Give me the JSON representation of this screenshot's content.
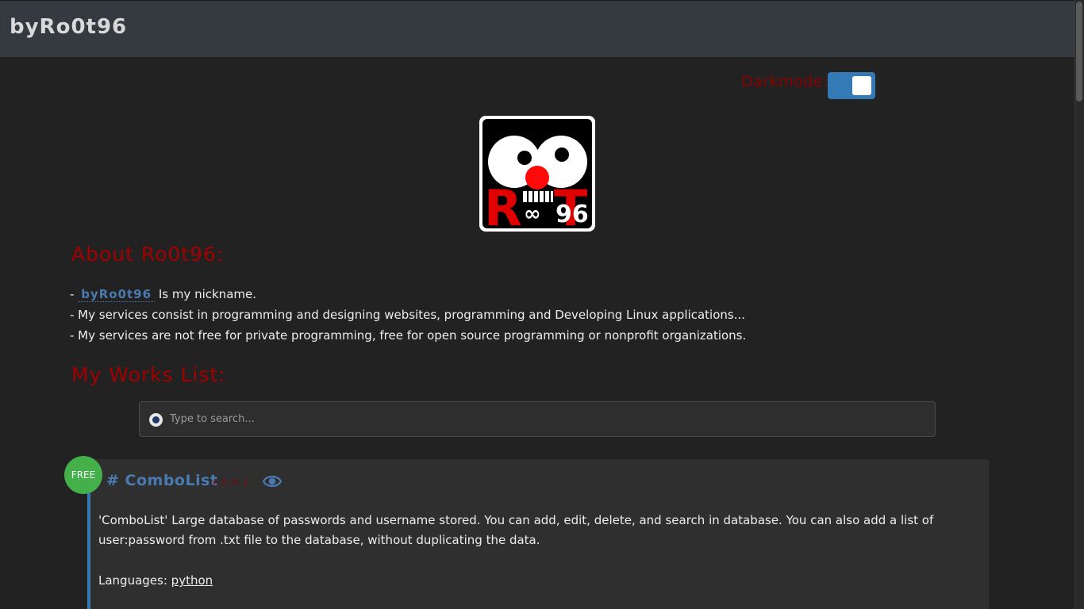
{
  "header": {
    "brand": "byRo0t96"
  },
  "darkmode": {
    "label": "Darkmode:",
    "enabled": true
  },
  "logo": {
    "alt": "Ro0t96 logo",
    "text_top": "OO",
    "text_mid": "R",
    "text_inf": "∞",
    "text_t": "T",
    "text_num": "96"
  },
  "about": {
    "heading": "About Ro0t96:",
    "line1_prefix": "- ",
    "nickname": "byRo0t96",
    "line1_suffix": " Is my nickname.",
    "line2": "- My services consist in programming and designing websites, programming and Developing Linux applications...",
    "line3": "- My services are not free for private programming, free for open source programming or nonprofit organizations."
  },
  "works": {
    "heading": "My Works List:",
    "search_placeholder": "Type to search...",
    "items": [
      {
        "badge": "FREE",
        "title": "# ComboList",
        "version": "v.0.0.1",
        "description": "'ComboList' Large database of passwords and username stored. You can add, edit, delete, and search in database. You can also add a list of user:password from .txt file to the database, without duplicating the data.",
        "languages_label": "Languages: ",
        "languages": "python"
      }
    ]
  },
  "colors": {
    "accent": "#337ab7",
    "heading_red": "#a50000",
    "badge_green": "#43b04a",
    "topbar": "#343a40",
    "background": "#222222"
  }
}
